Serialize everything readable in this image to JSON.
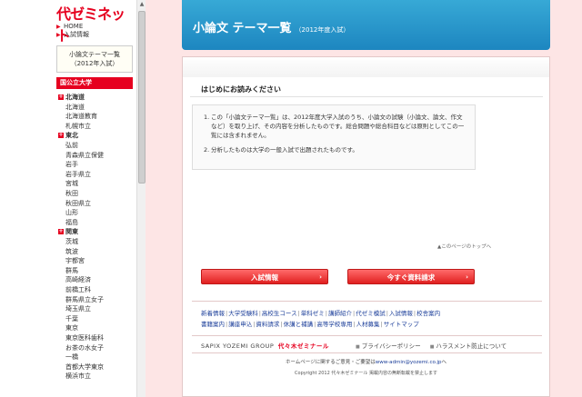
{
  "sidebar": {
    "logo": "代ゼミネット",
    "nav": [
      {
        "label": "HOME"
      },
      {
        "label": "入試情報"
      }
    ],
    "theme_box": {
      "line1": "小論文テーマ一覧",
      "line2": "（2012年入試）"
    },
    "category": "国公立大学",
    "regions": [
      {
        "name": "北海道",
        "schools": [
          "北海道",
          "北海道教育",
          "札幌市立"
        ]
      },
      {
        "name": "東北",
        "schools": [
          "弘前",
          "青森県立保健",
          "岩手",
          "岩手県立",
          "宮城",
          "秋田",
          "秋田県立",
          "山形",
          "福島"
        ]
      },
      {
        "name": "関東",
        "schools": [
          "茨城",
          "筑波",
          "宇都宮",
          "群馬",
          "高崎経済",
          "前橋工科",
          "群馬県立女子",
          "埼玉県立",
          "千葉",
          "東京",
          "東京医科歯科",
          "お茶の水女子",
          "一橋",
          "首都大学東京",
          "横浜市立"
        ]
      }
    ]
  },
  "main": {
    "banner": {
      "title": "小論文 テーマ一覧",
      "subtitle": "（2012年度入試）"
    },
    "intro_title": "はじめにお読みください",
    "notes": [
      {
        "num": "1.",
        "text": "この「小論文テーマ一覧」は、2012年度大学入試のうち、小論文の試験（小論文、論文、作文など）を取り上げ、その内容を分析したものです。総合問題や総合科目などは原則としてこの一覧には含まれません。"
      },
      {
        "num": "2.",
        "text": "分析したものは大学の一般入試で出題されたものです。"
      }
    ],
    "page_top": "▲このページのトップへ",
    "buttons": {
      "entrance": "入試情報",
      "request": "今すぐ資料請求",
      "chevron": "›"
    },
    "footer_links": [
      "新着情報",
      "大学受験科",
      "高校生コース",
      "単科ゼミ",
      "講師紹介",
      "代ゼミ模試",
      "入試情報",
      "校舎案内",
      "書籍案内",
      "講座申込",
      "資料請求",
      "休講と補講",
      "高等学校専用",
      "人材募集",
      "サイトマップ"
    ],
    "sapix_label": "SAPIX YOZEMI GROUP",
    "sapix_brand": "代々木ゼミナール",
    "privacy": "プライバシーポリシー",
    "harassment": "ハラスメント防止について",
    "contact_prefix": "ホームページに関するご意見・ご要望は",
    "contact_email": "www-admin@yozemi.co.jp",
    "contact_suffix": "へ",
    "copyright": "Copyright 2012 代々木ゼミナール 掲載内容の無断転載を禁止します"
  },
  "colors": {
    "brand_red": "#e6001f",
    "banner_blue": "#2b98cc",
    "page_bg": "#fde5e5",
    "link_blue": "#1a3d99"
  }
}
